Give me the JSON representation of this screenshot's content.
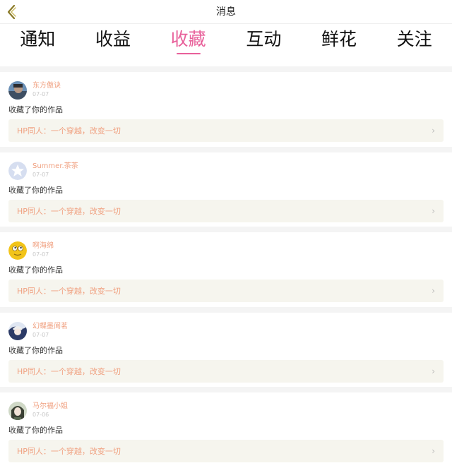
{
  "header": {
    "title": "消息"
  },
  "tabs": [
    {
      "label": "通知",
      "active": false
    },
    {
      "label": "收益",
      "active": false
    },
    {
      "label": "收藏",
      "active": true
    },
    {
      "label": "互动",
      "active": false
    },
    {
      "label": "鲜花",
      "active": false
    },
    {
      "label": "关注",
      "active": false
    }
  ],
  "colors": {
    "accent": "#e8609a",
    "username": "#f0a181",
    "work_bg": "#f6f5ee"
  },
  "items": [
    {
      "username": "东方傲诀",
      "date": "07-07",
      "action": "收藏了你的作品",
      "work": "HP同人：一个穿越，改变一切",
      "avatar": "photo-avatar"
    },
    {
      "username": "Summer.茶茶",
      "date": "07-07",
      "action": "收藏了你的作品",
      "work": "HP同人：一个穿越，改变一切",
      "avatar": "star-avatar"
    },
    {
      "username": "啊海绵",
      "date": "07-07",
      "action": "收藏了你的作品",
      "work": "HP同人：一个穿越，改变一切",
      "avatar": "emoji-avatar"
    },
    {
      "username": "幻蝶墨阆茗",
      "date": "07-07",
      "action": "收藏了你的作品",
      "work": "HP同人：一个穿越，改变一切",
      "avatar": "anime-avatar"
    },
    {
      "username": "马尔福小姐",
      "date": "07-06",
      "action": "收藏了你的作品",
      "work": "HP同人：一个穿越，改变一切",
      "avatar": "girl-avatar"
    }
  ]
}
